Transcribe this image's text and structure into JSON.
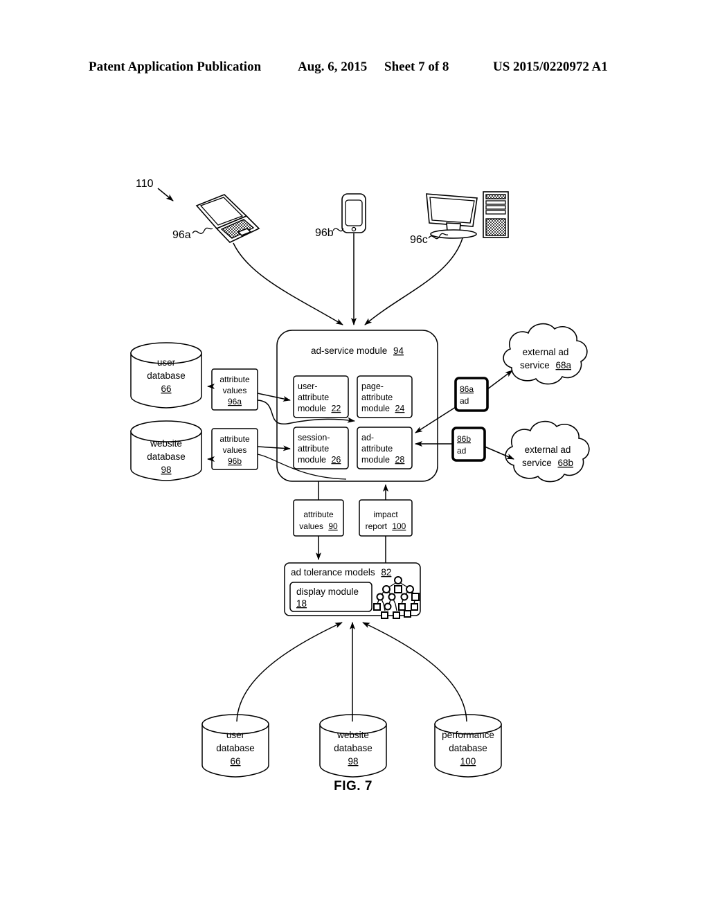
{
  "header": {
    "title": "Patent Application Publication",
    "date": "Aug. 6, 2015",
    "sheet": "Sheet 7 of 8",
    "publication": "US 2015/0220972 A1"
  },
  "figure": {
    "caption": "FIG. 7",
    "system_ref": "110"
  },
  "devices": [
    {
      "id": "96a",
      "label": "96a",
      "type": "laptop-icon"
    },
    {
      "id": "96b",
      "label": "96b",
      "type": "smartphone-icon"
    },
    {
      "id": "96c",
      "label": "96c",
      "type": "desktop-monitor-tower-icon"
    }
  ],
  "ad_service": {
    "title": "ad-service module",
    "ref": "94",
    "modules": [
      {
        "name": "user-\nattribute\nmodule",
        "line1": "user-",
        "line2": "attribute",
        "line3": "module",
        "ref": "22"
      },
      {
        "name": "page-attribute",
        "line1": "page-",
        "line2": "attribute",
        "line3": "module",
        "ref": "24"
      },
      {
        "name": "session-attribute",
        "line1": "session-",
        "line2": "attribute",
        "line3": "module",
        "ref": "26"
      },
      {
        "name": "ad-attribute",
        "line1": "ad-",
        "line2": "attribute",
        "line3": "module",
        "ref": "28"
      }
    ]
  },
  "left_databases": [
    {
      "line1": "user",
      "line2": "database",
      "ref": "66"
    },
    {
      "line1": "website",
      "line2": "database",
      "ref": "98"
    }
  ],
  "attribute_value_boxes": [
    {
      "line1": "attribute",
      "line2": "values",
      "ref": "96a"
    },
    {
      "line1": "attribute",
      "line2": "values",
      "ref": "96b"
    }
  ],
  "ads": [
    {
      "ref": "86a",
      "label": "ad"
    },
    {
      "ref": "86b",
      "label": "ad"
    }
  ],
  "external_services": [
    {
      "line1": "external ad",
      "line2": "service",
      "ref": "68a"
    },
    {
      "line1": "external ad",
      "line2": "service",
      "ref": "68b"
    }
  ],
  "middle": {
    "attribute_values": {
      "line1": "attribute",
      "line2": "values",
      "ref": "90"
    },
    "impact_report": {
      "line1": "impact",
      "line2": "report",
      "ref": "100"
    },
    "tolerance_models": {
      "label": "ad tolerance models",
      "ref": "82"
    },
    "display_module": {
      "label": "display module",
      "ref": "18"
    }
  },
  "bottom_databases": [
    {
      "line1": "user",
      "line2": "database",
      "ref": "66"
    },
    {
      "line1": "website",
      "line2": "database",
      "ref": "98"
    },
    {
      "line1": "performance",
      "line2": "database",
      "ref": "100"
    }
  ]
}
